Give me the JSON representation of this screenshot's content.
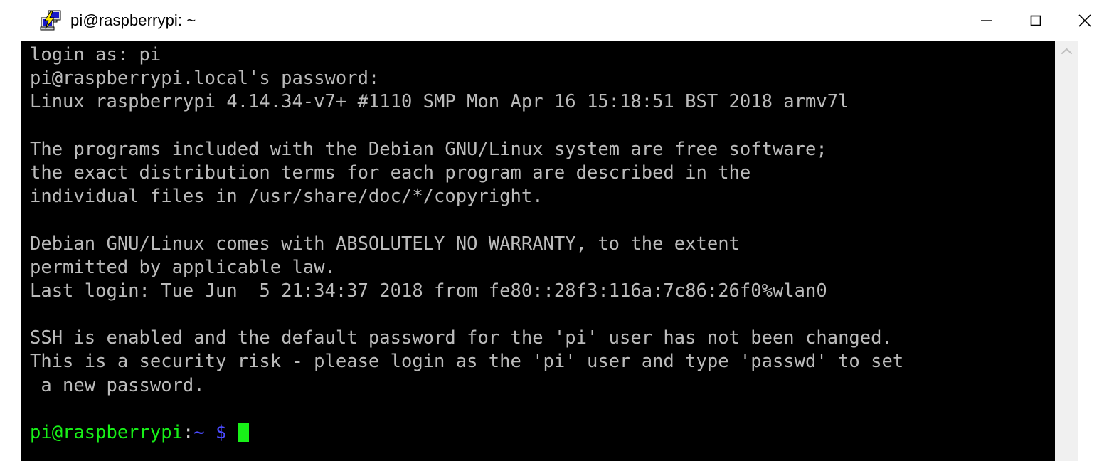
{
  "window": {
    "title": "pi@raspberrypi: ~",
    "icon": "putty-terminal-icon",
    "controls": {
      "minimize_label": "Minimize",
      "maximize_label": "Maximize",
      "close_label": "Close"
    }
  },
  "colors": {
    "terminal_background": "#000000",
    "terminal_foreground": "#bbbbbb",
    "prompt_user_host": "#18f018",
    "prompt_path": "#4a4aff",
    "cursor": "#18f018",
    "titlebar_background": "#ffffff",
    "scrollbar_track": "#f0f0f0"
  },
  "terminal": {
    "lines": [
      "login as: pi",
      "pi@raspberrypi.local's password:",
      "Linux raspberrypi 4.14.34-v7+ #1110 SMP Mon Apr 16 15:18:51 BST 2018 armv7l",
      "",
      "The programs included with the Debian GNU/Linux system are free software;",
      "the exact distribution terms for each program are described in the",
      "individual files in /usr/share/doc/*/copyright.",
      "",
      "Debian GNU/Linux comes with ABSOLUTELY NO WARRANTY, to the extent",
      "permitted by applicable law.",
      "Last login: Tue Jun  5 21:34:37 2018 from fe80::28f3:116a:7c86:26f0%wlan0",
      "",
      "SSH is enabled and the default password for the 'pi' user has not been changed.",
      "This is a security risk - please login as the 'pi' user and type 'passwd' to set",
      " a new password.",
      ""
    ],
    "prompt": {
      "user_host": "pi@raspberrypi",
      "separator": ":",
      "path": "~",
      "symbol": "$",
      "input": "",
      "cursor_visible": true
    }
  },
  "scrollbar": {
    "up_arrow_icon": "chevron-up-icon",
    "position": "top"
  }
}
